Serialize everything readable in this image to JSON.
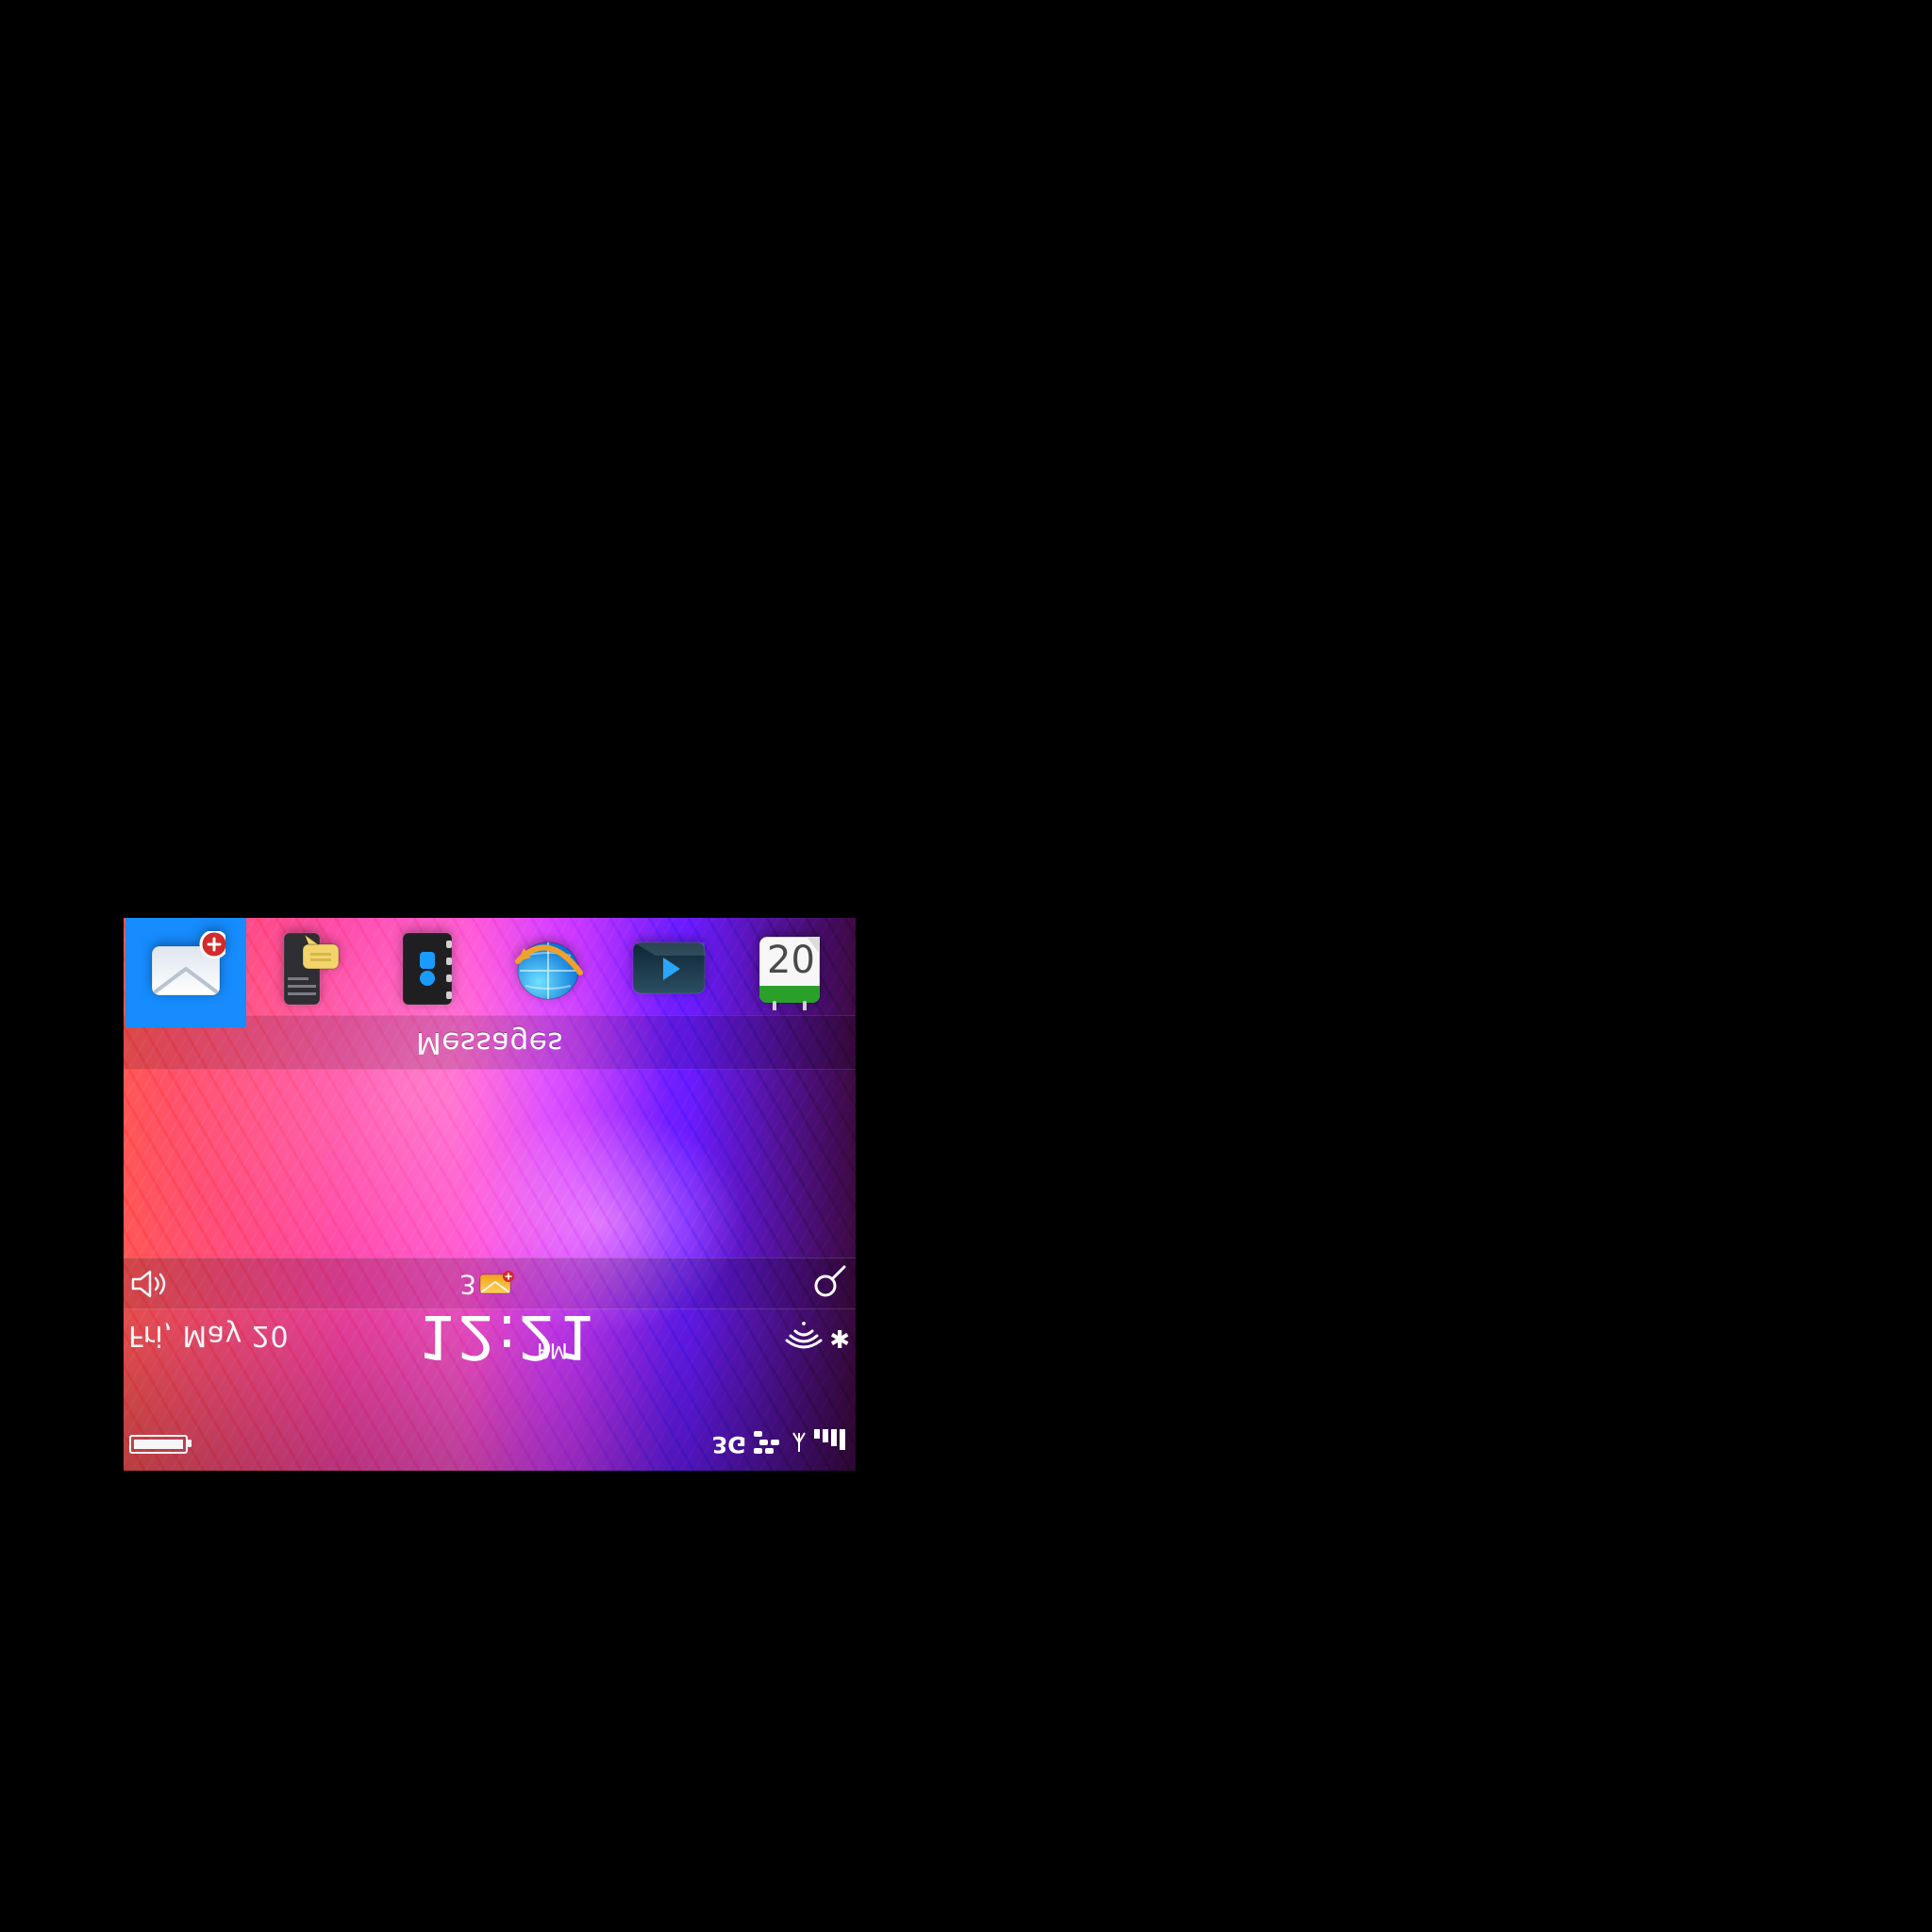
{
  "status": {
    "date": "Fri, May 20",
    "time": "12:21",
    "ampm": "PM",
    "network": "3G"
  },
  "notifications": {
    "message_count": "3"
  },
  "home": {
    "title": "Messages"
  },
  "dock": {
    "items": [
      {
        "icon": "messages-icon"
      },
      {
        "icon": "text-messages-icon"
      },
      {
        "icon": "contacts-icon"
      },
      {
        "icon": "browser-icon"
      },
      {
        "icon": "media-icon"
      },
      {
        "icon": "calendar-icon",
        "label": "20"
      }
    ]
  },
  "colors": {
    "selected_blue": "#168cff"
  }
}
